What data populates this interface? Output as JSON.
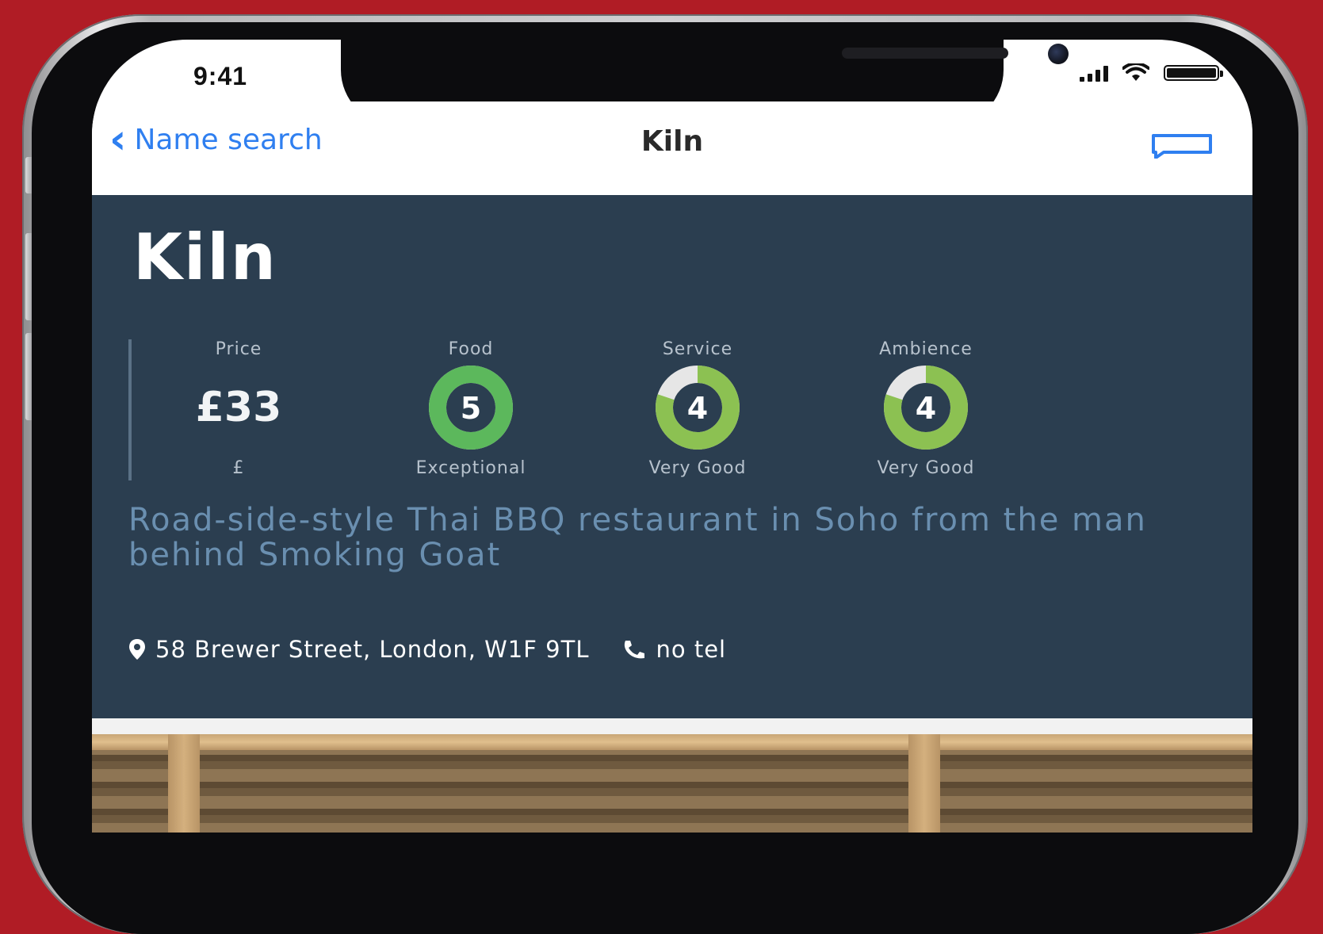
{
  "status_bar": {
    "time": "9:41"
  },
  "nav": {
    "back_label": "Name search",
    "title": "Kiln",
    "action_icon": "message-icon"
  },
  "restaurant": {
    "name": "Kiln",
    "description": "Road-side-style Thai BBQ restaurant in Soho from the man behind Smoking Goat",
    "address": "58 Brewer Street, London, W1F 9TL",
    "tel": "no tel"
  },
  "ratings": {
    "price": {
      "label": "Price",
      "value": "£33",
      "sub": "£"
    },
    "food": {
      "label": "Food",
      "score": "5",
      "max": 5,
      "sub": "Exceptional"
    },
    "service": {
      "label": "Service",
      "score": "4",
      "max": 5,
      "sub": "Very Good"
    },
    "ambience": {
      "label": "Ambience",
      "score": "4",
      "max": 5,
      "sub": "Very Good"
    }
  },
  "colors": {
    "background": "#b01c25",
    "panel": "#2b3e50",
    "ring_food": "#5cb85c",
    "ring_good": "#8cc152",
    "ring_empty": "#e6e6e6",
    "link": "#2f7ff0",
    "description": "#6a8fb0"
  }
}
